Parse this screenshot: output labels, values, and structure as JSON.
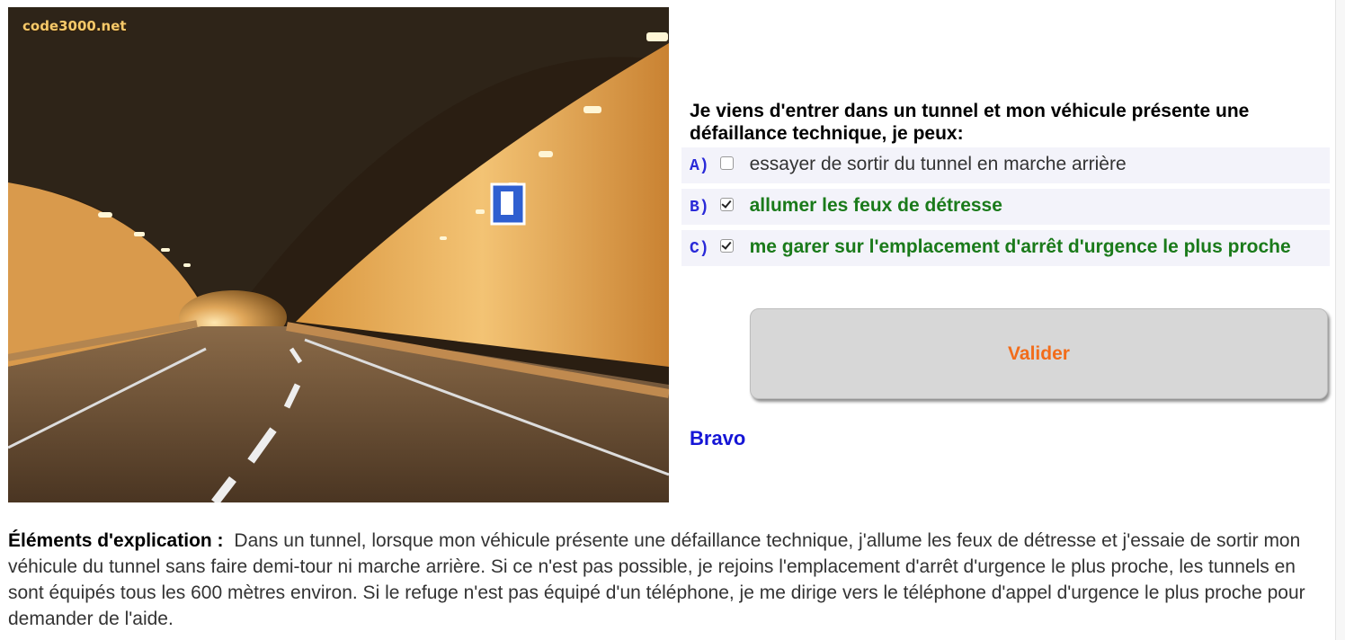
{
  "image": {
    "watermark": "code3000.net",
    "alt": "tunnel"
  },
  "question": "Je viens d'entrer dans un tunnel et mon véhicule présente une défaillance technique, je peux:",
  "answers": [
    {
      "letter": "A)",
      "text": "essayer de sortir du tunnel en marche arrière",
      "checked": false,
      "correct": false
    },
    {
      "letter": "B)",
      "text": "allumer les feux de détresse",
      "checked": true,
      "correct": true
    },
    {
      "letter": "C)",
      "text": "me garer sur l'emplacement d'arrêt d'urgence le plus proche",
      "checked": true,
      "correct": true
    }
  ],
  "validate_label": "Valider",
  "result": "Bravo",
  "explanation": {
    "label": "Éléments d'explication :",
    "text": "Dans un tunnel, lorsque mon véhicule présente une défaillance technique, j'allume les feux de détresse et j'essaie de sortir mon véhicule du tunnel sans faire demi-tour ni marche arrière. Si ce n'est pas possible, je rejoins l'emplacement d'arrêt d'urgence le plus proche, les tunnels en sont équipés tous les 600 mètres environ. Si le refuge n'est pas équipé d'un téléphone, je me dirige vers le téléphone d'appel d'urgence le plus proche pour demander de l'aide."
  },
  "colors": {
    "question": "#000000",
    "letter": "#2a2ad8",
    "correct": "#1a7a1a",
    "button_text": "#f26c1a",
    "result": "#1515d6"
  }
}
